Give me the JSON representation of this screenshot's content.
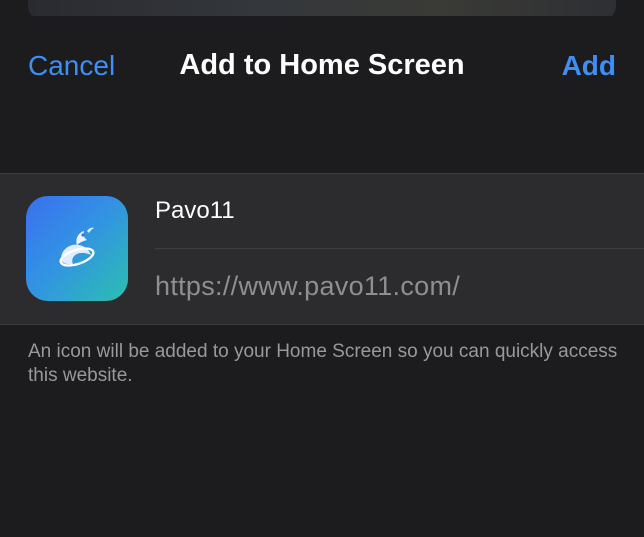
{
  "header": {
    "cancel_label": "Cancel",
    "title": "Add to Home Screen",
    "add_label": "Add"
  },
  "bookmark": {
    "name": "Pavo11",
    "url": "https://www.pavo11.com/",
    "icon": "pavo11-app-icon"
  },
  "footnote": "An icon will be added to your Home Screen so you can quickly access this website.",
  "colors": {
    "background": "#1c1c1e",
    "card": "#2c2c2e",
    "accent": "#3d8ff5",
    "secondary_text": "#8e8e93"
  }
}
